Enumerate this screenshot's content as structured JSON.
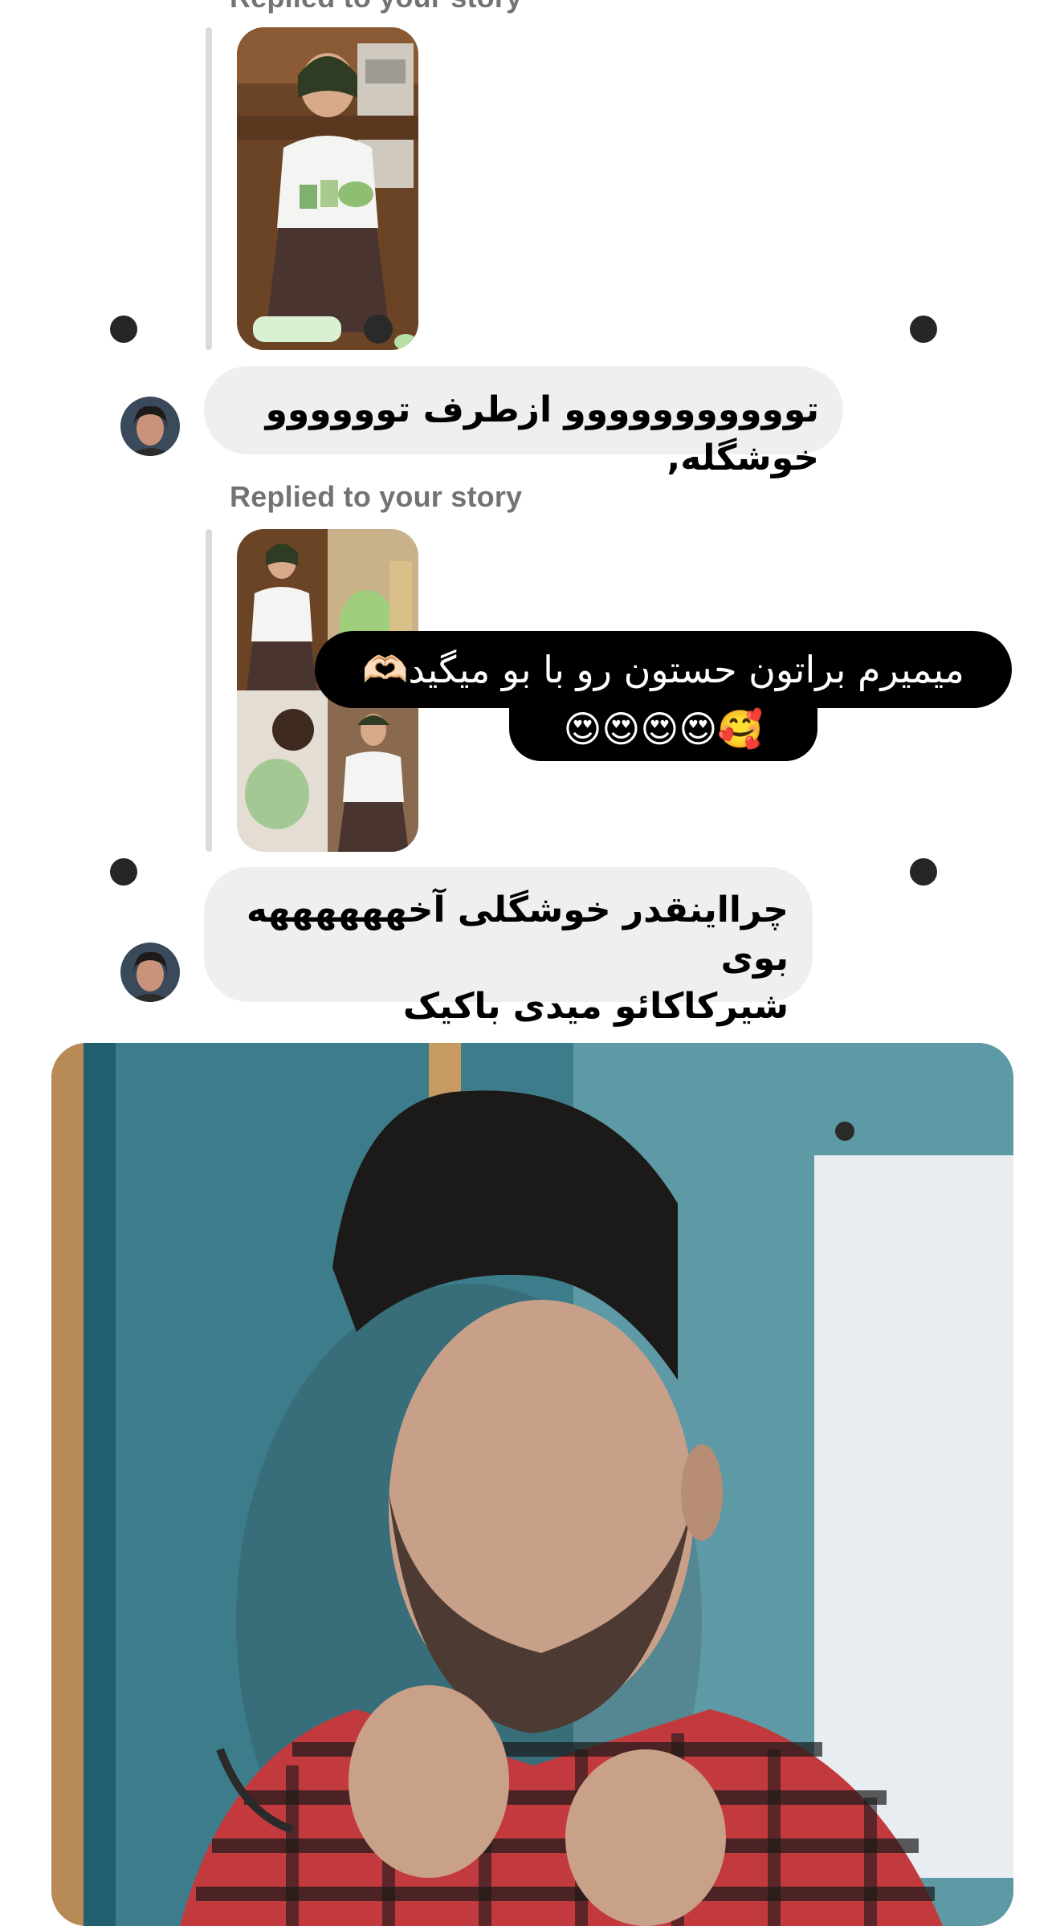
{
  "messages": [
    {
      "reply_label": "Replied to your story",
      "text": "تووووووووووو ازطرف توووووو خوشگله,"
    },
    {
      "reply_label": "Replied to your story",
      "story_caption_line1": "میمیرم براتون حستون رو با بو میگید🫶🏻",
      "story_caption_line2": "🥰😍😍😍😍",
      "text": "چرااینقدر خوشگلی آخههههههه بوی\nشیرکاکائو میدی باکیک"
    }
  ],
  "icons": {
    "left_dot": "reaction-dot-icon",
    "right_dot": "reaction-dot-icon"
  },
  "colors": {
    "bubble": "#efefef",
    "label": "#737373",
    "caption_bg": "#000000"
  }
}
